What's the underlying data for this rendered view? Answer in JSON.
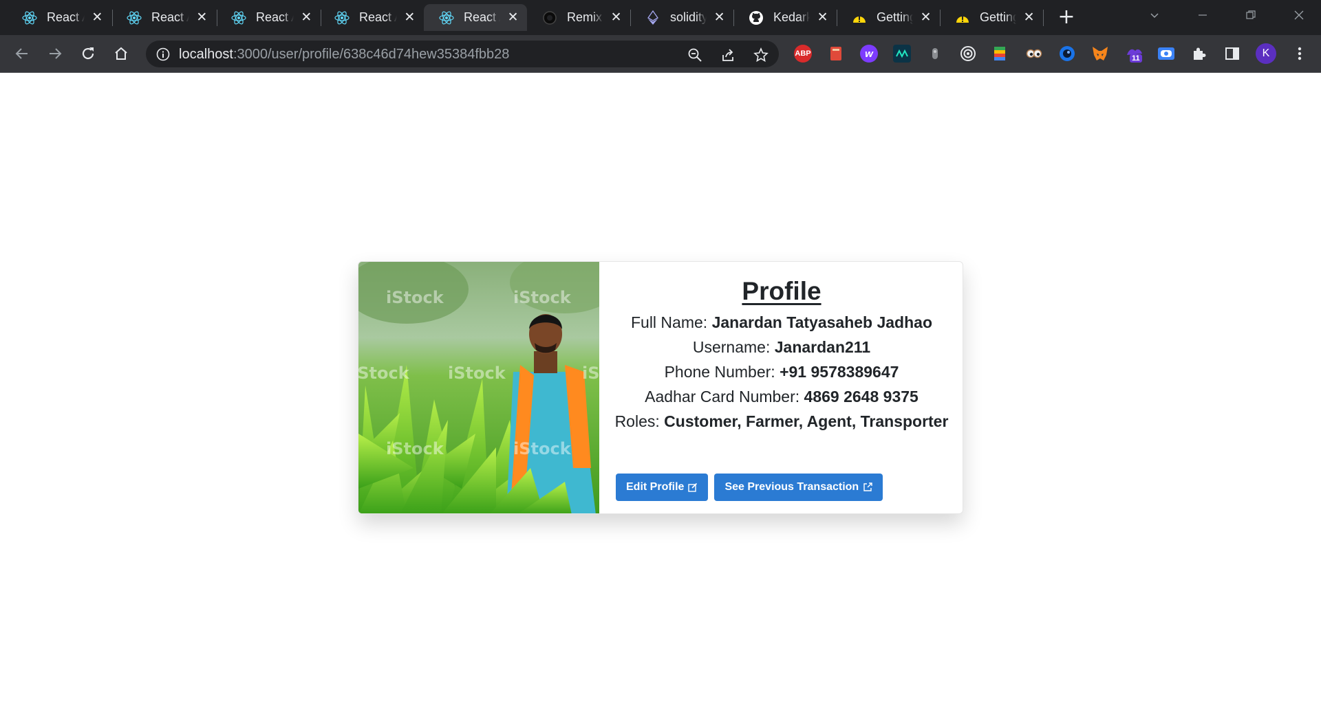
{
  "browser": {
    "tabs": [
      {
        "title": "React App",
        "icon": "react-icon",
        "active": false
      },
      {
        "title": "React App",
        "icon": "react-icon",
        "active": false
      },
      {
        "title": "React App",
        "icon": "react-icon",
        "active": false
      },
      {
        "title": "React App",
        "icon": "react-icon",
        "active": false
      },
      {
        "title": "React App",
        "icon": "react-icon",
        "active": true
      },
      {
        "title": "Remix",
        "icon": "remix-icon",
        "active": false
      },
      {
        "title": "solidity",
        "icon": "ethereum-icon",
        "active": false
      },
      {
        "title": "Kedark",
        "icon": "github-icon",
        "active": false
      },
      {
        "title": "Getting",
        "icon": "warning-icon",
        "active": false
      },
      {
        "title": "Getting",
        "icon": "warning-icon",
        "active": false
      }
    ],
    "url_host": "localhost",
    "url_path": ":3000/user/profile/638c46d74hew35384fbb28",
    "extension_badge": "11",
    "profile_initial": "K",
    "extensions": [
      "adblock-plus",
      "red-book",
      "purple-w",
      "teal-ext",
      "gray-ext",
      "target-ext",
      "google-keep",
      "eyes-ext",
      "blue-circle-ext",
      "metamask",
      "purple-hat-ext",
      "screen-ext"
    ]
  },
  "profile": {
    "title": "Profile",
    "full_name_label": "Full Name:",
    "full_name": "Janardan Tatyasaheb Jadhao",
    "username_label": "Username:",
    "username": "Janardan211",
    "phone_label": "Phone Number:",
    "phone": "+91 9578389647",
    "aadhar_label": "Aadhar Card Number:",
    "aadhar": "4869 2648 9375",
    "roles_label": "Roles:",
    "roles": "Customer, Farmer, Agent, Transporter",
    "edit_button": "Edit Profile",
    "transactions_button": "See Previous Transaction",
    "watermark": "iStock"
  },
  "colors": {
    "button_bg": "#2b7bd3",
    "chrome_bg": "#202124",
    "toolbar_bg": "#35363a",
    "text": "#212529"
  }
}
